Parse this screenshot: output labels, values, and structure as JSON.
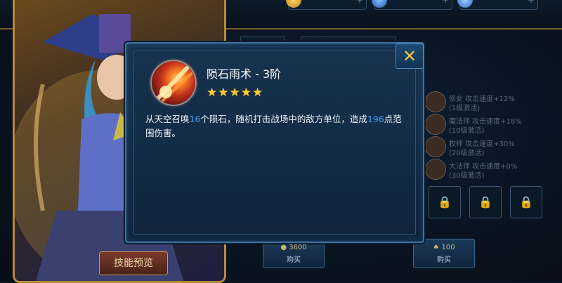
{
  "popup": {
    "title": "陨石雨术 - 3阶",
    "stars": "★★★★★",
    "desc_prefix": "从天空召唤",
    "desc_count": "16",
    "desc_mid": "个陨石，随机打击战场中的敌方单位，造成",
    "desc_damage": "196",
    "desc_suffix": "点范围伤害。",
    "close_label": "✕"
  },
  "hero": {
    "skill_preview_label": "技能预览"
  },
  "side_list": [
    {
      "line1": "修女 攻击速度+12%",
      "line2": "(1级激活)"
    },
    {
      "line1": "魔法师 攻击速度+18%",
      "line2": "(10级激活)"
    },
    {
      "line1": "牧师 攻击速度+30%",
      "line2": "(20级激活)"
    },
    {
      "line1": "大法师 攻击速度+0%",
      "line2": "(30级激活)"
    }
  ],
  "buy_buttons": [
    {
      "price": "3600",
      "label": "购买"
    },
    {
      "price": "100",
      "label": "购买"
    }
  ],
  "colors": {
    "highlight": "#3aa3ff",
    "stars": "#ffcc33",
    "gold_border": "#b8893c"
  }
}
